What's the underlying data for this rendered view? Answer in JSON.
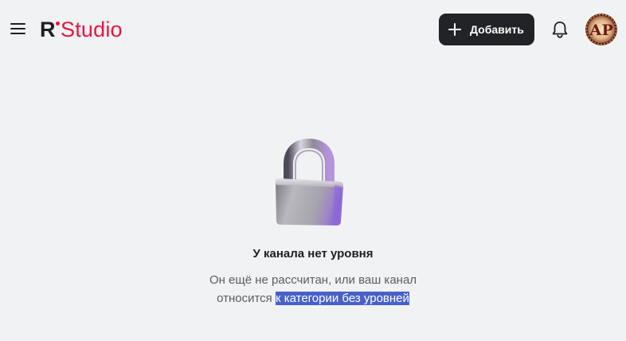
{
  "header": {
    "menu_icon": "hamburger-menu-icon",
    "logo": {
      "r": "R",
      "studio": "Studio"
    },
    "add_button": {
      "label": "Добавить",
      "icon": "plus-icon"
    },
    "notifications_icon": "bell-icon",
    "avatar": {
      "initials": "АР"
    }
  },
  "empty_state": {
    "icon": "padlock-icon",
    "title": "У канала нет уровня",
    "description_line1": "Он ещё не рассчитан, или ваш канал",
    "description_line2_prefix": "относится ",
    "description_line2_selected": "к категории без уровней"
  },
  "colors": {
    "background": "#f1f2f4",
    "brand_red": "#e8173d",
    "button_dark": "#222326",
    "selection": "#4860c9"
  }
}
